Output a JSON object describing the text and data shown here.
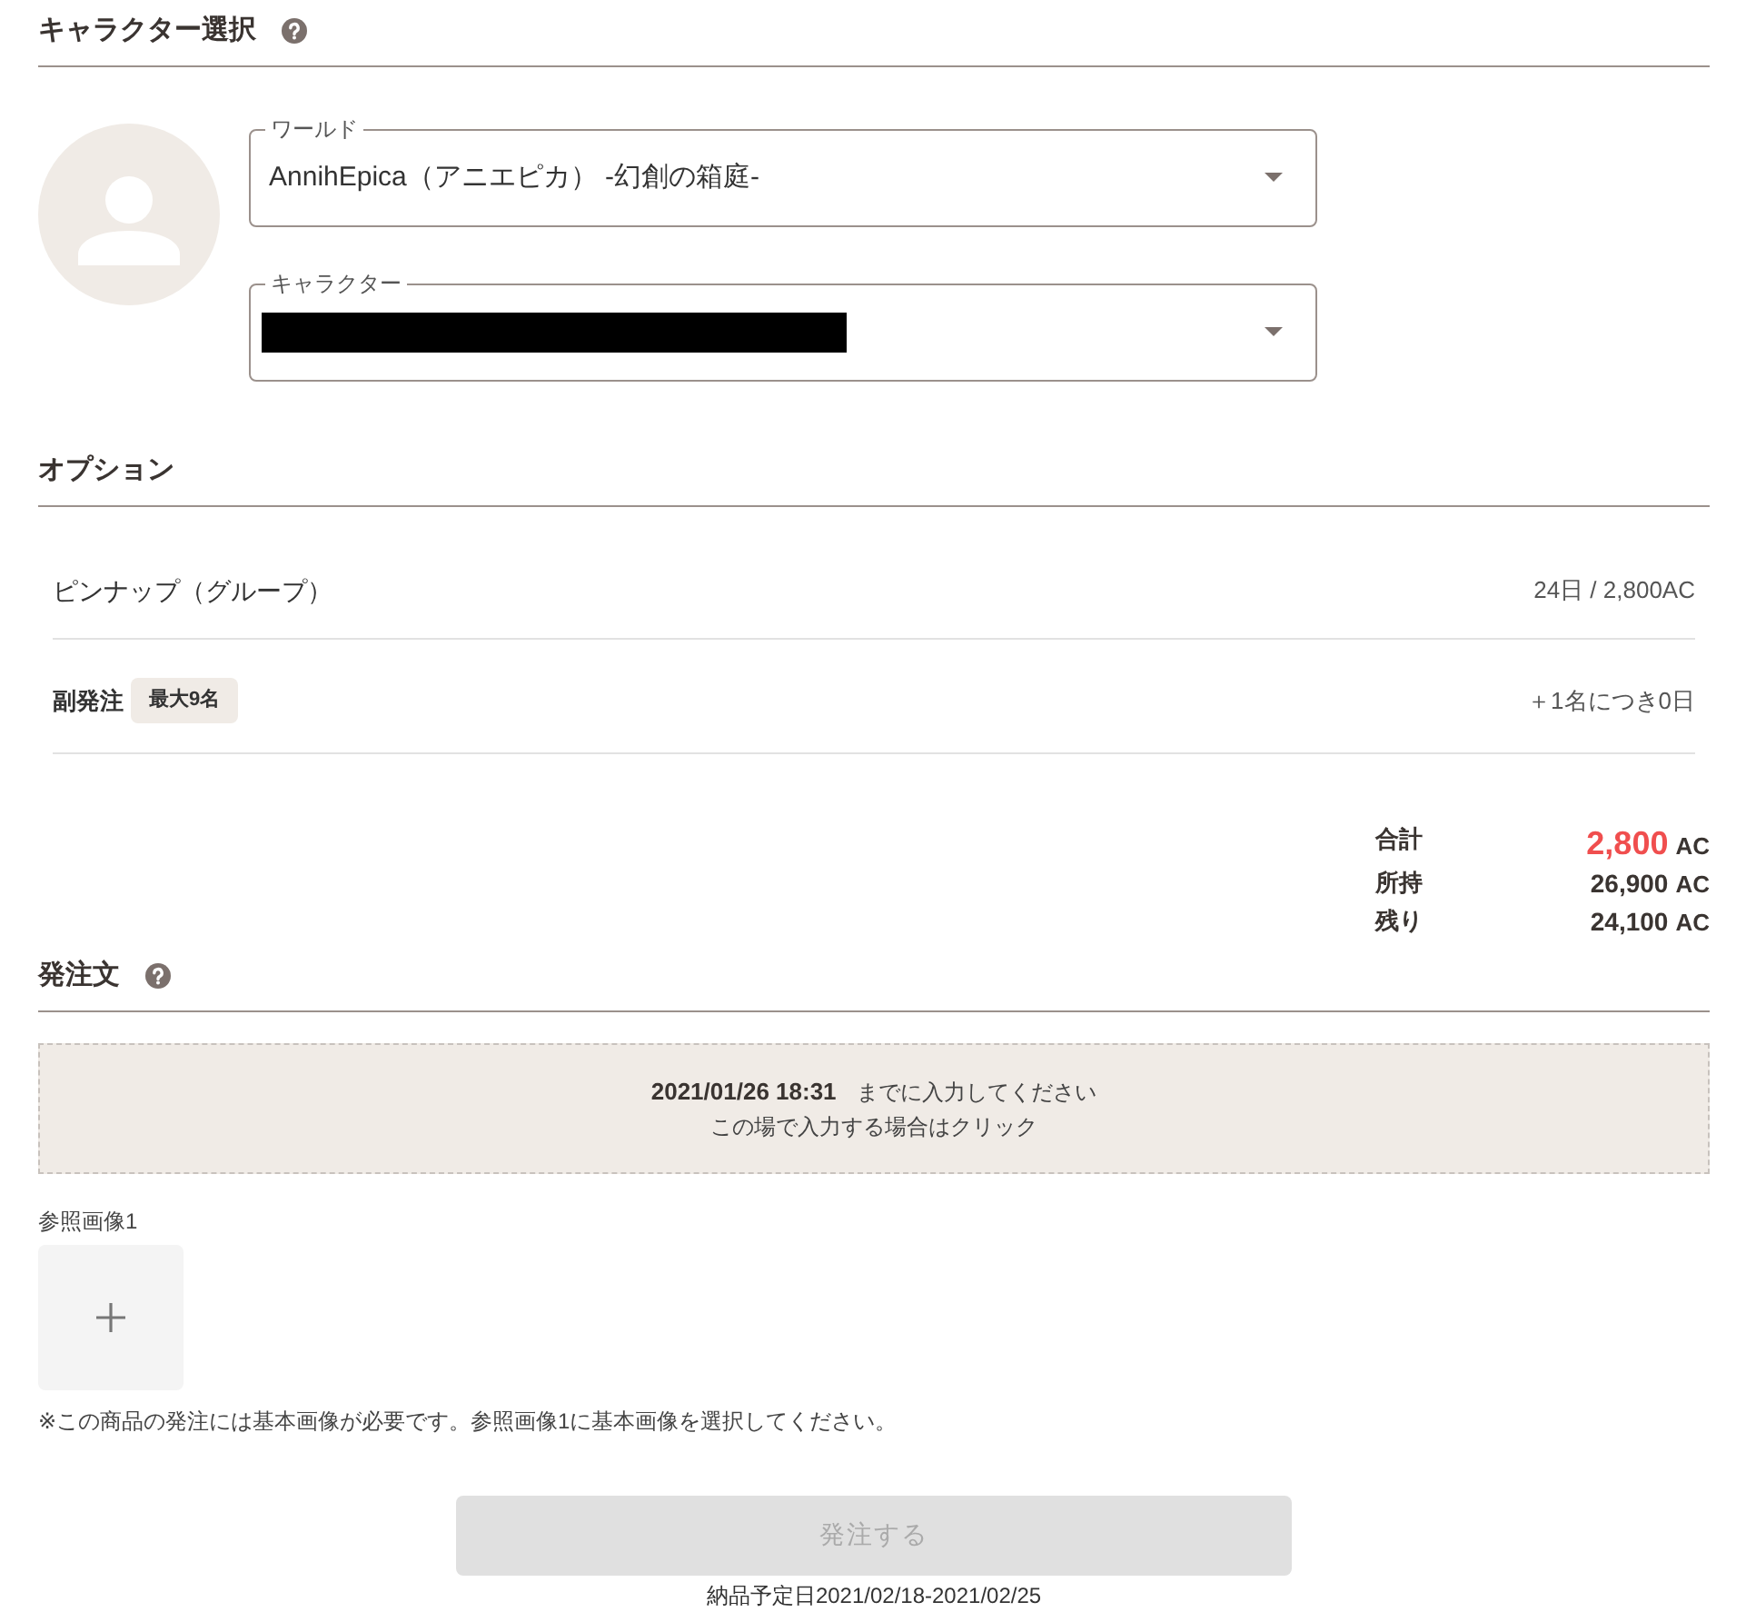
{
  "character_section": {
    "title": "キャラクター選択",
    "help": true,
    "fields": [
      {
        "label": "ワールド",
        "value": "AnnihEpica（アニエピカ） -幻創の箱庭-",
        "redacted": false
      },
      {
        "label": "キャラクター",
        "redacted": true
      }
    ]
  },
  "options_section": {
    "title": "オプション",
    "options": [
      {
        "kind": "main",
        "name": "ピンナップ（グループ）",
        "detail": "24日 / 2,800AC"
      },
      {
        "kind": "extra",
        "name": "副発注",
        "badge": "最大9名",
        "detail": "＋1名につき0日"
      }
    ]
  },
  "totals": [
    {
      "label": "合計",
      "amount": "2,800",
      "unit": "AC",
      "highlight": true
    },
    {
      "label": "所持",
      "amount": "26,900",
      "unit": "AC",
      "highlight": false
    },
    {
      "label": "残り",
      "amount": "24,100",
      "unit": "AC",
      "highlight": false
    }
  ],
  "order_section": {
    "title": "発注文",
    "help": true,
    "entry": {
      "deadline": "**2021/01/26 18:31** までに入力してください",
      "hint": "この場で入力する場合はクリック"
    },
    "reference_image": {
      "label": "参照画像1"
    },
    "note": "※この商品の発注には基本画像が必要です。参照画像1に基本画像を選択してください。"
  },
  "submit": {
    "label": "発注する",
    "disabled": true
  },
  "delivery": "納品予定日2021/02/18-2021/02/25"
}
